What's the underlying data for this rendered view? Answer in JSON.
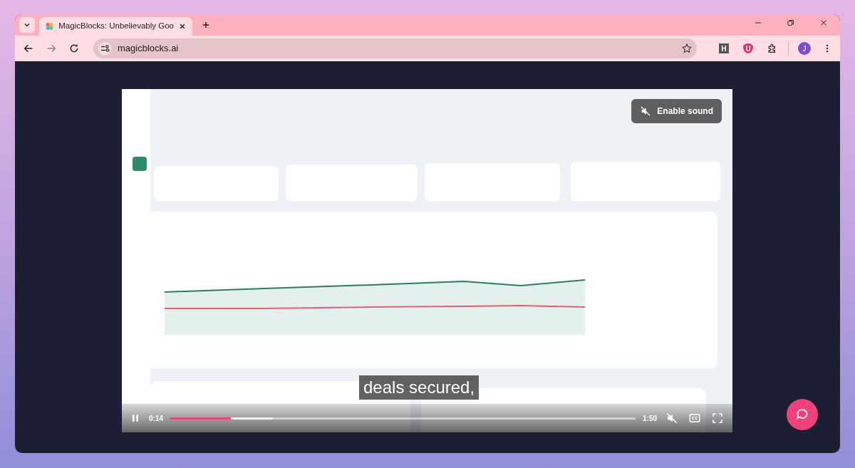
{
  "tabs": [
    {
      "title": "MagicBlocks: Unbelievably Goo",
      "selected": true
    }
  ],
  "address_bar": {
    "url": "magicblocks.ai"
  },
  "extensions": [
    {
      "label": "H",
      "kind": "square"
    },
    {
      "label": "U",
      "kind": "shield"
    }
  ],
  "profile": {
    "initial": "J"
  },
  "video": {
    "kind": "picture",
    "sound_button": "Enable sound",
    "caption": "deals secured,",
    "elapsed": "0:14",
    "duration": "1:50",
    "playing": true,
    "muted": true,
    "progress": {
      "level": 0.13,
      "buffered": {
        "level": 0.22
      }
    }
  }
}
